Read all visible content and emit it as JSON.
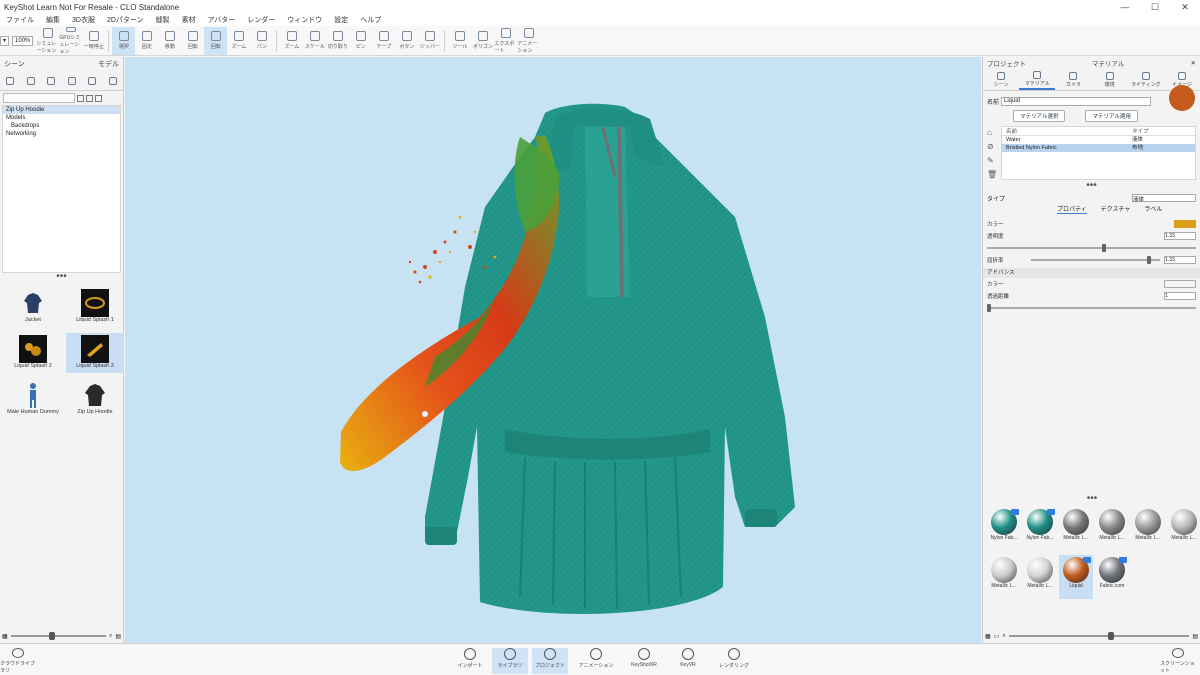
{
  "window": {
    "title": "KeyShot Learn Not For Resale - CLO Standalone",
    "controls": [
      "—",
      "☐",
      "✕"
    ]
  },
  "menu": [
    "ファイル",
    "編集",
    "3D衣服",
    "2Dパターン",
    "縫製",
    "素材",
    "アバター",
    "レンダー",
    "ウィンドウ",
    "設定",
    "ヘルプ"
  ],
  "toolbar": {
    "zoom_value": "100%",
    "items": [
      "シミュレーション",
      "GPUシミュレーション",
      "一時停止",
      "選択",
      "固定",
      "移動",
      "回転",
      "回転",
      "ズーム",
      "パン",
      "ズーム",
      "スケール",
      "切り取り",
      "ピン",
      "テープ",
      "ボタン",
      "ジッパー",
      "ツール",
      "ポリゴン",
      "エクスポート",
      "アニメーション"
    ]
  },
  "left": {
    "tabs": [
      "シーン",
      "モデル"
    ],
    "search_placeholder": "",
    "tree": [
      "Zip Up Hoodie",
      "Models",
      "Backdrops",
      "Networking"
    ],
    "library": [
      {
        "label": "Jacket",
        "color": "#2b3e66"
      },
      {
        "label": "Liquid Splash 1",
        "color": "#c58a10"
      },
      {
        "label": "Liquid Splash 2",
        "color": "#d99a18"
      },
      {
        "label": "Liquid Splash 3",
        "color": "#e0a020"
      },
      {
        "label": "Male Human Dummy",
        "color": "#3a6fb0"
      },
      {
        "label": "Zip Up Hoodie",
        "color": "#2a2a2a"
      }
    ]
  },
  "right": {
    "head_left": "プロジェクト",
    "head_right": "マテリアル",
    "tabs": [
      "シーン",
      "マテリアル",
      "カメラ",
      "環境",
      "ライティング",
      "イメージ"
    ],
    "name_label": "名前",
    "name_value": "Liquid",
    "btn_copy": "マテリアル選択",
    "btn_assign": "マテリアル適用",
    "table_headers": [
      "名前",
      "タイプ"
    ],
    "table_rows": [
      {
        "name": "Water",
        "type": "液体"
      },
      {
        "name": "Bristled Nylon Fabric",
        "type": "布地"
      }
    ],
    "type_label": "タイプ",
    "type_value": "液体",
    "prop_tabs": [
      "プロパティ",
      "テクスチャ",
      "ラベル"
    ],
    "props": [
      {
        "label": "カラー",
        "value": ""
      },
      {
        "label": "透明度",
        "value": "1.33"
      },
      {
        "label": "屈折率",
        "value": "1.33"
      }
    ],
    "section": "アドバンス",
    "adv": [
      {
        "label": "カラー",
        "value": ""
      },
      {
        "label": "透過距離",
        "value": "1"
      }
    ],
    "swatches": [
      {
        "label": "Nylon Fab...",
        "color": "#1e8f86",
        "badge": true
      },
      {
        "label": "Nylon Fab...",
        "color": "#1e8f86",
        "badge": true
      },
      {
        "label": "Metallic L...",
        "color": "#777777",
        "badge": false
      },
      {
        "label": "Metallic L...",
        "color": "#8a8a8a",
        "badge": false
      },
      {
        "label": "Metallic L...",
        "color": "#9a9a9a",
        "badge": false
      },
      {
        "label": "Metallic L...",
        "color": "#b8b8b8",
        "badge": false
      },
      {
        "label": "Metallic L...",
        "color": "#cccccc",
        "badge": false
      },
      {
        "label": "Metallic L...",
        "color": "#d4d4d4",
        "badge": false
      },
      {
        "label": "Liquid",
        "color": "#c45a1c",
        "badge": true
      },
      {
        "label": "Fabric.com",
        "color": "#707478",
        "badge": true
      }
    ]
  },
  "bottom": {
    "left_label": "クラウドライブラリ",
    "right_label": "スクリーンショット",
    "items": [
      "インポート",
      "ライブラリ",
      "プロジェクト",
      "アニメーション",
      "KeyShotXR",
      "KeyVR",
      "レンダリング"
    ]
  },
  "colors": {
    "viewport_bg": "#c7e2f3",
    "garment": "#23988a",
    "accent": "#3a7bd5"
  }
}
